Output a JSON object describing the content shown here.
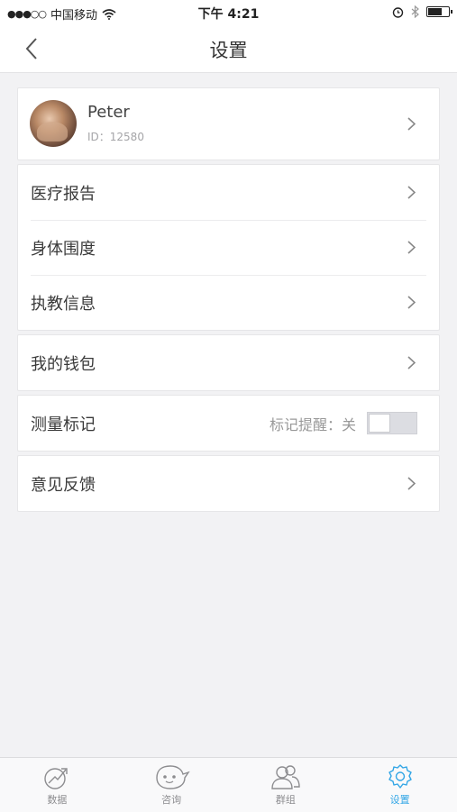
{
  "status_bar": {
    "signal_dots": "●●●○○",
    "carrier": "中国移动",
    "time": "下午 4:21",
    "battery_level": 0.7
  },
  "nav": {
    "title": "设置",
    "back_icon": "chevron-left-icon"
  },
  "profile": {
    "name": "Peter",
    "id_text": "ID：12580"
  },
  "menu_group_1": [
    {
      "label": "医疗报告"
    },
    {
      "label": "身体围度"
    },
    {
      "label": "执教信息"
    }
  ],
  "wallet": {
    "label": "我的钱包"
  },
  "measure": {
    "label": "测量标记",
    "reminder_text": "标记提醒：关",
    "toggle_on": false
  },
  "feedback": {
    "label": "意见反馈"
  },
  "tabs": [
    {
      "label": "数据",
      "icon": "chart-icon",
      "active": false
    },
    {
      "label": "咨询",
      "icon": "chat-face-icon",
      "active": false
    },
    {
      "label": "群组",
      "icon": "group-icon",
      "active": false
    },
    {
      "label": "设置",
      "icon": "gear-icon",
      "active": true
    }
  ],
  "colors": {
    "accent": "#32a6e6",
    "background": "#f2f2f4",
    "tab_inactive": "#8d8d90"
  }
}
